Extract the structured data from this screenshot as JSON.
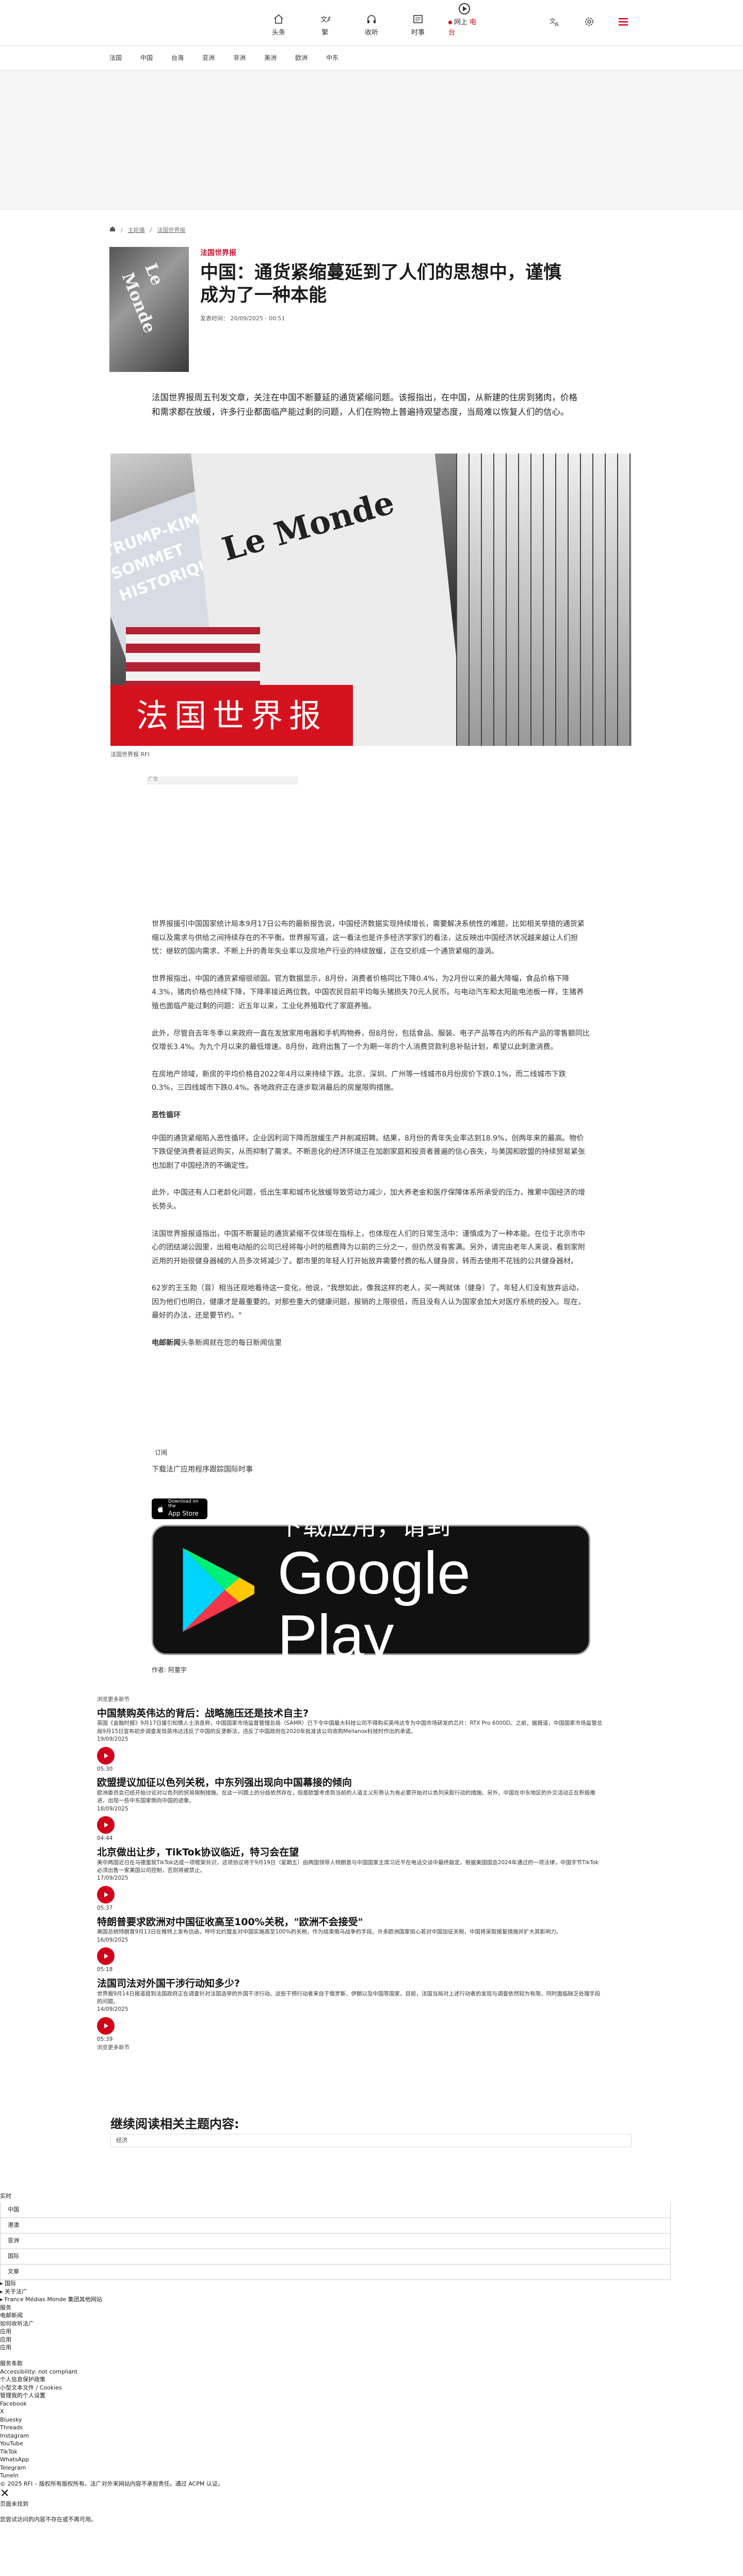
{
  "header": {
    "nav": [
      {
        "label": "头条",
        "icon": "home-icon"
      },
      {
        "label": "繁",
        "icon": "traditional-chinese-icon"
      },
      {
        "label": "收听",
        "icon": "headphones-icon"
      },
      {
        "label": "时事",
        "icon": "newspaper-icon"
      }
    ],
    "live": {
      "prefix": "网上",
      "suffix": "电台"
    },
    "tools": [
      "translate-icon",
      "gear-icon",
      "menu-icon"
    ]
  },
  "sections": [
    "法国",
    "中国",
    "台海",
    "亚洲",
    "非洲",
    "美洲",
    "欧洲",
    "中东"
  ],
  "breadcrumb": [
    "主轮播",
    "法国世界报"
  ],
  "article": {
    "kicker": "法国世界报",
    "title": "中国：通货紧缩蔓延到了人们的思想中，谨慎成为了一种本能",
    "meta": "发表时间：  20/09/2025 - 00:51",
    "lede": "法国世界报周五刊发文章，关注在中国不断蔓延的通货紧缩问题。该报指出，在中国，从新建的住房到猪肉，价格和需求都在放缓，许多行业都面临产能过剩的问题，人们在购物上普遍持观望态度，当局难以恢复人们的信心。",
    "image_caption": "法国世界报 RFI",
    "image_text": {
      "paper": "Le Monde",
      "headline": "TRUMP-KIM: UN SOMMET HISTORIQUE",
      "band": "法国世界报"
    },
    "ad_label": "广告",
    "paragraphs": [
      "世界报援引中国国家统计局本9月17日公布的最新报告说，中国经济数据实现持续增长，需要解决系统性的难题，比如相关举措的通货紧缩以及需求与供给之间持续存在的不平衡。世界报写道，这一看法也是许多经济学家们的看法，这反映出中国经济状况越来越让人们担忧：继软的国内需求、不断上升的青年失业率以及房地产行业的持续放缓，正在交织成一个通货紧缩的漩涡。",
      "世界报指出，中国的通货紧缩很顽固。官方数据显示，8月份，消费者价格同比下降0.4%，为2月份以来的最大降幅，食品价格下降4.3%，猪肉价格也持续下降，下降率接近两位数。中国农民目前平均每头猪损失70元人民币。与电动汽车和太阳能电池板一样，生猪养殖也面临产能过剩的问题：近五年以来，工业化养殖取代了家庭养殖。",
      "此外，尽管自去年冬季以来政府一直在发放家用电器和手机购物券，但8月份，包括食品、服装、电子产品等在内的所有产品的零售额同比仅增长3.4%。为九个月以来的最低增速。8月份，政府出售了一个为期一年的个人消费贷款利息补贴计划，希望以此刺激消费。",
      "在房地产领域，新房的平均价格自2022年4月以来持续下跌。北京、深圳、广州等一线城市8月份房价下跌0.1%，而二线城市下跌0.3%，三四线城市下跌0.4%。各地政府正在逐步取消最后的房屋限购措施。"
    ],
    "subhead": "恶性循环",
    "paragraphs2": [
      "中国的通货紧缩陷入恶性循环。企业因利润下降而放缓生产并削减招聘。结果，8月份的青年失业率达到18.9%，创两年来的最高。物价下跌促使消费者延迟购买，从而抑制了需求。不断恶化的经济环境正在加剧家庭和投资者普遍的信心丧失，与美国和欧盟的持续贸易紧张也加剧了中国经济的不确定性。",
      "此外，中国还有人口老龄化问题，低出生率和城市化放缓导致劳动力减少，加大养老金和医疗保障体系所承受的压力，推累中国经济的增长势头。",
      "法国世界报报道指出，中国不断蔓延的通货紧缩不仅体现在指标上，也体现在人们的日常生活中：谨慎成为了一种本能。在位于北京市中心的团结湖公园里，出租电动船的公司已经将每小时的租费降为以前的三分之一，但仍然没有客满。另外，请完由老年人来说，看到家附近用的开始很健身器械的人员多次将减少了。都市里的年轻人打开始放弃需要付费的私人健身房，转而去使用不花钱的公共健身器材。",
      "62岁的王玉勃（音）相当还观地看待这一变化，他说，\"我想如此，像我这样的老人，买一两就体（健身）了。年轻人们没有放弃运动，因为他们也明白，健康才是最重要的。对那些重大的健康问题，报销的上限很低，而且没有人认为国家会加大对医疗系统的投入。现在，最好的办法，还是要节约。\""
    ],
    "signoff_bold": "电邮新闻",
    "signoff_rest": "头条新闻就在您的每日新闻信里",
    "subscribe_label": "订阅",
    "promo": "下载法广应用程序跟踪国际时事",
    "appstore": {
      "small": "Download on the",
      "big": "App Store"
    },
    "gplay": {
      "line1": "下载应用，请到",
      "line2": "Google Play"
    },
    "author": "作者:  阿董宇"
  },
  "related": {
    "caption": "浏览更多新节",
    "items": [
      {
        "title": "中国禁购英伟达的背后：战略施压还是技术自主?",
        "summary": "英国《金融时报》9月17日援引知情人士消息称，中国国家市场监督管理总局（SAMR）已下令中国最大科技公司不得购买英伟达专为中国市场研发的芯片：RTX Pro 6000D。之前，据报道，中国国家市场监管总局9月15日宣布初步调查发现英伟达违反了中国的反垄断法，违反了中国政府在2020年批准该公司收购Mellanox科技时作出的承诺。",
        "date": "19/09/2025",
        "duration": "05:30"
      },
      {
        "title": "欧盟提议加征以色列关税，中东列强出现向中国幕接的倾向",
        "summary": "欧洲委员会已经开始讨论对以色列的贸易限制措施。在这一问题上的分歧依然存在，但是欧盟考虑到当前的人道主义形势认为有必要开始对以色列采取行动的措施。另外，中国在中东地区的外交活动正在积极推进，出现一些中东国家倒向中国的迹象。",
        "date": "18/09/2025",
        "duration": "04:44"
      },
      {
        "title": "北京做出让步，TikTok协议临近，特习会在望",
        "summary": "美中两国近日在马德里就TikTok达成一项框架共识，这项协议将于9月19日（星期五）由两国领导人特朗普与中国国家主席习近平在电话交谈中最终敲定。根据美国国会2024年通过的一项法律，中国字节TikTok必须出售一家美国公司控制，否则将被禁止。",
        "date": "17/09/2025",
        "duration": "05:37"
      },
      {
        "title": "特朗普要求欧洲对中国征收高至100%关税，\"欧洲不会接受\"",
        "summary": "美国总统特朗普9月13日在推特上发布信函，呼吁北约盟友对中国实施高至100%的关税，作为结束俄乌战争的手段。许多欧洲国家担心若对中国加征关税，中国将采取报复措施并扩大其影响力。",
        "date": "16/09/2025",
        "duration": "05:18"
      },
      {
        "title": "法国司法对外国干涉行动知多少?",
        "summary": "世界报9月14日报道提到法国政府正在调查针对法国选举的外国干涉行动。这些干预行动者来自于俄罗斯、伊朗以及中国等国家。目前，法国当局对上述行动者的发现与调查依然较为有限，同时面临缺乏处理手段的问题。",
        "date": "14/09/2025",
        "duration": "05:39"
      }
    ],
    "end": "浏览更多新节"
  },
  "more": {
    "heading": "继续阅读相关主题内容:",
    "tag": "经济"
  },
  "live_block": {
    "title": "实时",
    "rows": [
      "中国",
      "港澳",
      "亚洲",
      "国际",
      "文章"
    ]
  },
  "footer": {
    "lines": [
      "▸ 国际",
      "▸ 关于法广",
      "▸ France Médias Monde 集团其他网站",
      "服务",
      "电邮新闻",
      "如何收听法广",
      "应用",
      "应用",
      "应用",
      "",
      "服务条款",
      "Accessibility: not compliant",
      "个人信息保护政策",
      "小型文本文件 / Cookies",
      "管理我的个人设置",
      "Facebook",
      "X",
      "Bluesky",
      "Threads",
      "Instagram",
      "YouTube",
      "TikTok",
      "WhatsApp",
      "Telegram",
      "TuneIn",
      "© 2025 RFI – 版权所有版权所有。法广对外来网站内容不承担责任。通过 ACPM 认证。",
      "✕",
      "页面未找到",
      "您尝试访问的内容不存在或不再可用。"
    ]
  },
  "colors": {
    "brand_red": "#d0021b",
    "kicker_red": "#c8102e",
    "text": "#1a1a1a"
  }
}
